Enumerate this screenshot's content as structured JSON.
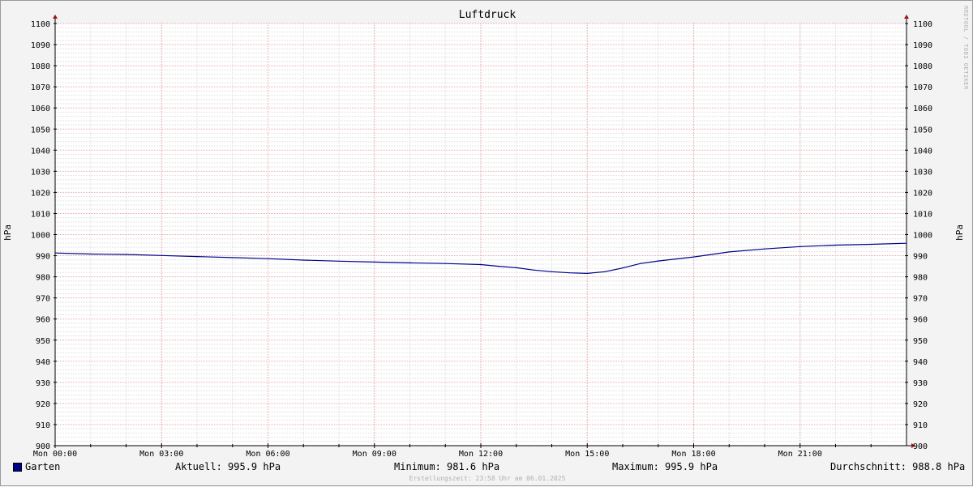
{
  "chart_data": {
    "type": "line",
    "title": "Luftdruck",
    "ylabel": "hPa",
    "xlabel": "",
    "ylim": [
      900,
      1100
    ],
    "y_ticks": [
      900,
      910,
      920,
      930,
      940,
      950,
      960,
      970,
      980,
      990,
      1000,
      1010,
      1020,
      1030,
      1040,
      1050,
      1060,
      1070,
      1080,
      1090,
      1100
    ],
    "x_ticks": [
      "Mon 00:00",
      "Mon 03:00",
      "Mon 06:00",
      "Mon 09:00",
      "Mon 12:00",
      "Mon 15:00",
      "Mon 18:00",
      "Mon 21:00"
    ],
    "xlim_hours": [
      0,
      24
    ],
    "grid": true,
    "series": [
      {
        "name": "Garten",
        "color": "#00008b",
        "x_hours": [
          0,
          1,
          2,
          3,
          4,
          5,
          6,
          7,
          8,
          9,
          10,
          11,
          12,
          12.5,
          13,
          13.5,
          14,
          14.5,
          15,
          15.5,
          16,
          16.5,
          17,
          18,
          19,
          20,
          21,
          22,
          23,
          24
        ],
        "values": [
          991.3,
          990.8,
          990.6,
          990.1,
          989.6,
          989.1,
          988.6,
          987.9,
          987.4,
          987.0,
          986.6,
          986.3,
          985.8,
          985.0,
          984.3,
          983.2,
          982.4,
          981.9,
          981.6,
          982.4,
          984.2,
          986.3,
          987.5,
          989.4,
          991.8,
          993.2,
          994.3,
          995.0,
          995.4,
          995.9
        ]
      }
    ]
  },
  "legend": {
    "series_name": "Garten",
    "current": "Aktuell: 995.9 hPa",
    "minimum": "Minimum: 981.6 hPa",
    "maximum": "Maximum: 995.9 hPa",
    "average": "Durchschnitt: 988.8 hPa"
  },
  "watermark": "RRDTOOL / TOBI OETIKER",
  "footer": "Erstellungszeit: 23:58 Uhr am 06.01.2025"
}
